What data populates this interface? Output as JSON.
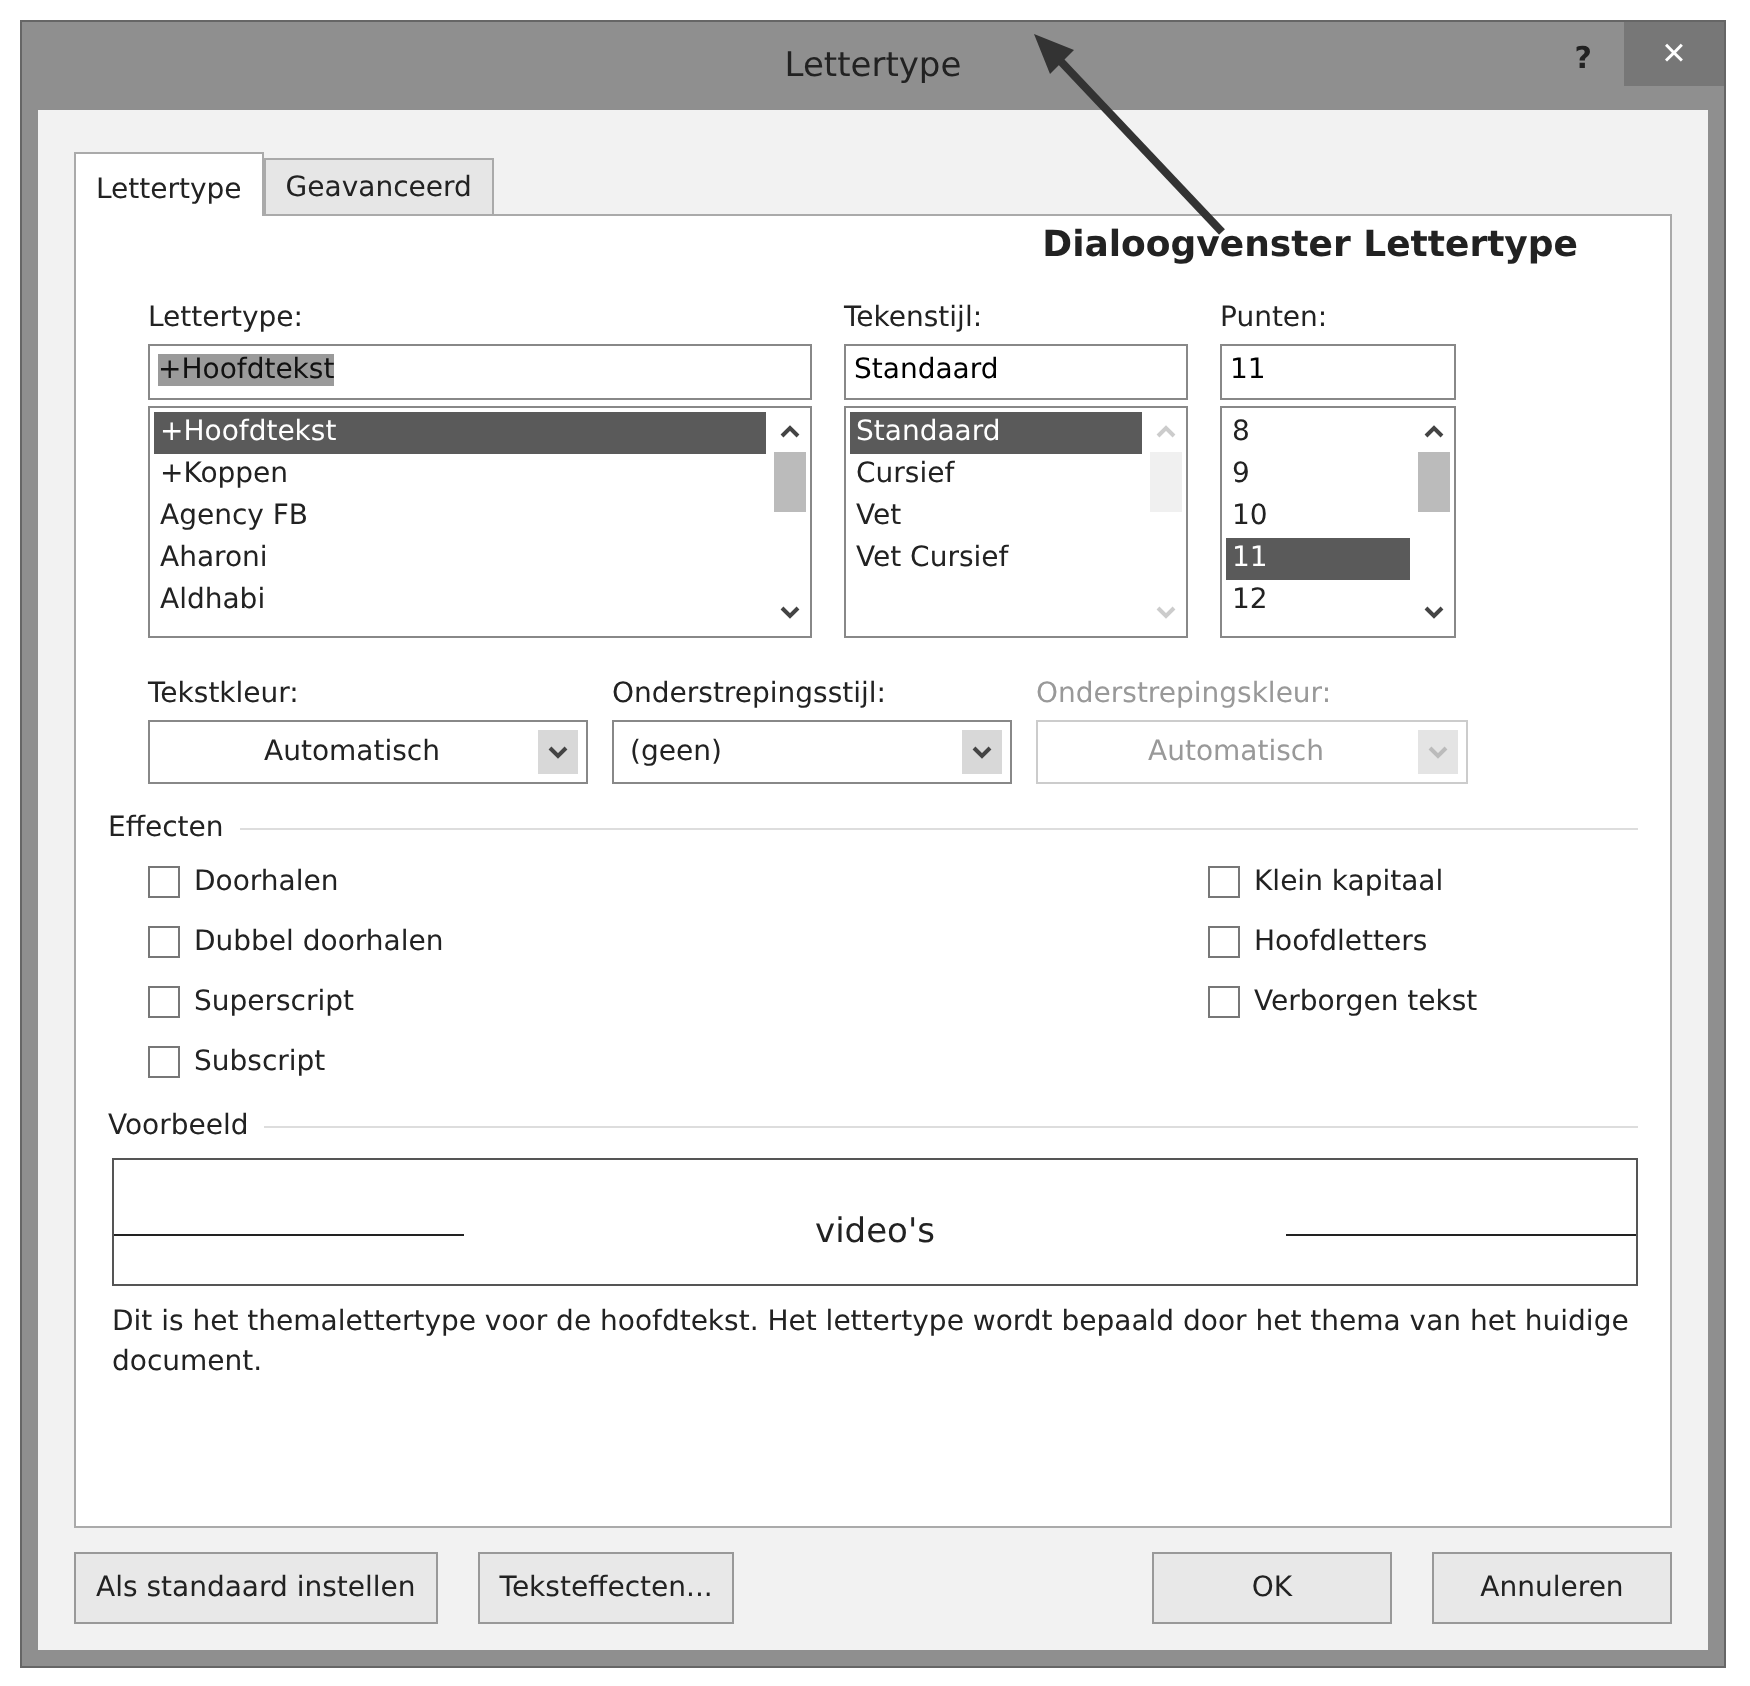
{
  "window": {
    "title": "Lettertype",
    "help_button": "?",
    "close_button": "×"
  },
  "annotation": {
    "text": "Dialoogvenster Lettertype"
  },
  "tabs": [
    {
      "label": "Lettertype",
      "selected": true
    },
    {
      "label": "Geavanceerd",
      "selected": false
    }
  ],
  "pickers": [
    {
      "label": "Lettertype:",
      "value": "+Hoofdtekst",
      "value_selected": true,
      "scroll_enabled": true,
      "items": [
        {
          "label": "+Hoofdtekst",
          "selected": true
        },
        {
          "label": "+Koppen",
          "selected": false
        },
        {
          "label": "Agency FB",
          "selected": false
        },
        {
          "label": "Aharoni",
          "selected": false
        },
        {
          "label": "Aldhabi",
          "selected": false
        }
      ]
    },
    {
      "label": "Tekenstijl:",
      "value": "Standaard",
      "value_selected": false,
      "scroll_enabled": false,
      "items": [
        {
          "label": "Standaard",
          "selected": true
        },
        {
          "label": "Cursief",
          "selected": false
        },
        {
          "label": "Vet",
          "selected": false
        },
        {
          "label": "Vet Cursief",
          "selected": false
        }
      ]
    },
    {
      "label": "Punten:",
      "value": "11",
      "value_selected": false,
      "scroll_enabled": true,
      "items": [
        {
          "label": "8",
          "selected": false
        },
        {
          "label": "9",
          "selected": false
        },
        {
          "label": "10",
          "selected": false
        },
        {
          "label": "11",
          "selected": true
        },
        {
          "label": "12",
          "selected": false
        }
      ]
    }
  ],
  "dropdowns": [
    {
      "label": "Tekstkleur:",
      "value": "Automatisch",
      "kind": "color",
      "disabled": false
    },
    {
      "label": "Onderstrepingsstijl:",
      "value": "(geen)",
      "kind": "list",
      "disabled": false
    },
    {
      "label": "Onderstrepingskleur:",
      "value": "Automatisch",
      "kind": "color",
      "disabled": true
    }
  ],
  "effects": {
    "title": "Effecten",
    "left": [
      {
        "label": "Doorhalen",
        "checked": false
      },
      {
        "label": "Dubbel doorhalen",
        "checked": false
      },
      {
        "label": "Superscript",
        "checked": false
      },
      {
        "label": "Subscript",
        "checked": false
      }
    ],
    "right": [
      {
        "label": "Klein kapitaal",
        "checked": false
      },
      {
        "label": "Hoofdletters",
        "checked": false
      },
      {
        "label": "Verborgen tekst",
        "checked": false
      }
    ]
  },
  "preview": {
    "title": "Voorbeeld",
    "sample": "video's",
    "description": "Dit is het themalettertype voor de hoofdtekst. Het lettertype wordt bepaald door het thema van het huidige document."
  },
  "buttons": [
    {
      "label": "Als standaard instellen"
    },
    {
      "label": "Teksteffecten..."
    },
    {
      "label": "OK"
    },
    {
      "label": "Annuleren"
    }
  ]
}
